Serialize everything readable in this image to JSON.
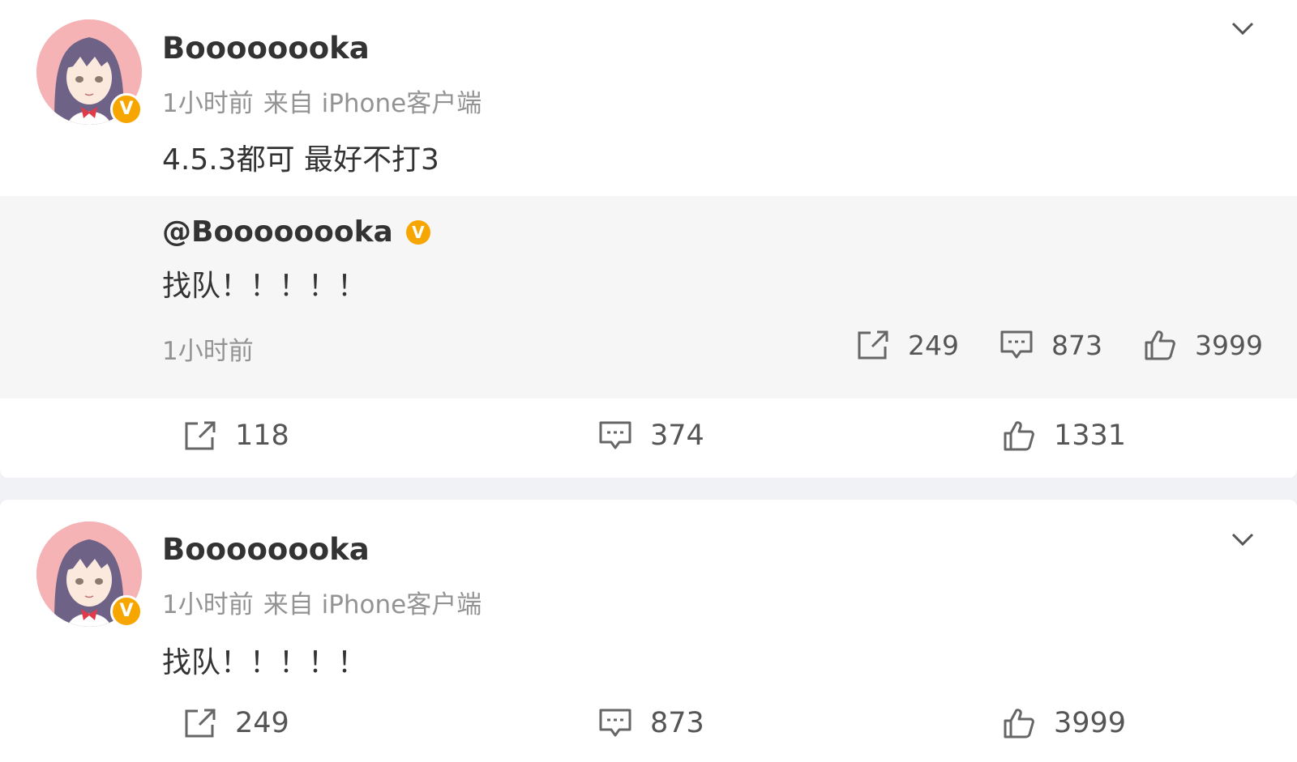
{
  "posts": [
    {
      "username": "Boooooooka",
      "time": "1小时前",
      "source": "来自 iPhone客户端",
      "text": "4.5.3都可 最好不打3",
      "verified_badge": "V",
      "repost": {
        "username": "@Boooooooka",
        "verified_badge": "V",
        "text": "找队！！！！！",
        "time": "1小时前",
        "shares": "249",
        "comments": "873",
        "likes": "3999"
      },
      "shares": "118",
      "comments": "374",
      "likes": "1331"
    },
    {
      "username": "Boooooooka",
      "time": "1小时前",
      "source": "来自 iPhone客户端",
      "text": "找队！！！！！",
      "verified_badge": "V",
      "shares": "249",
      "comments": "873",
      "likes": "3999"
    }
  ],
  "icons": {
    "share": "share-icon",
    "comment": "comment-icon",
    "like": "like-icon",
    "expand": "chevron-down-icon"
  },
  "colors": {
    "badge": "#f7a600",
    "meta_text": "#939393",
    "repost_bg": "#f6f6f7",
    "page_bg": "#f1f2f5"
  }
}
